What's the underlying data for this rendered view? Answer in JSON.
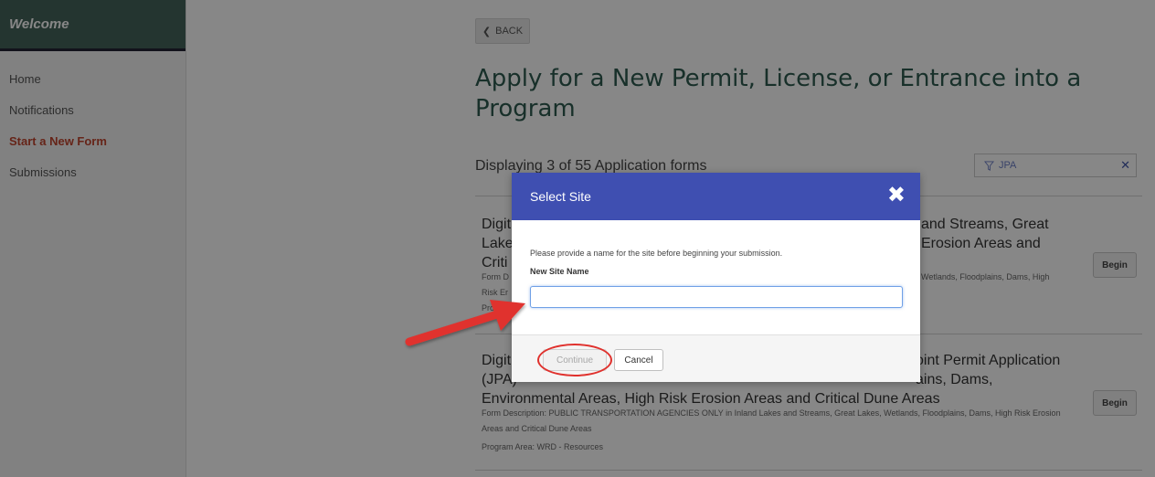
{
  "sidebar": {
    "header": "Welcome",
    "items": [
      {
        "label": "Home"
      },
      {
        "label": "Notifications"
      },
      {
        "label": "Start a New Form",
        "active": true
      },
      {
        "label": "Submissions"
      }
    ]
  },
  "main": {
    "back_label": "BACK",
    "title": "Apply for a New Permit, License, or Entrance into a Program",
    "displaying": "Displaying 3 of 55 Application forms",
    "filter_value": "JPA",
    "forms": [
      {
        "title_left": "Digit\nLake\nCriti",
        "title_right": "and Streams, Great\nErosion Areas and",
        "desc_left": "Form D",
        "desc_right": "Wetlands, Floodplains, Dams, High",
        "desc_left_2": "Risk Er",
        "prog_left": "Pro",
        "begin_label": "Begin"
      },
      {
        "title_line1_left": "Digit",
        "title_line1_right": "oint Permit Application",
        "title_line2_left": "(JPA)",
        "title_line2_right": "ains, Dams,",
        "title_line3": "Environmental Areas, High Risk Erosion Areas and Critical Dune Areas",
        "description": "Form Description: PUBLIC TRANSPORTATION AGENCIES ONLY in Inland Lakes and Streams, Great Lakes, Wetlands, Floodplains, Dams, High Risk Erosion Areas and Critical Dune Areas",
        "program_area": "Program Area: WRD - Resources",
        "begin_label": "Begin"
      }
    ]
  },
  "modal": {
    "title": "Select Site",
    "instruction": "Please provide a name for the site before beginning your submission.",
    "field_label": "New Site Name",
    "field_value": "",
    "continue_label": "Continue",
    "cancel_label": "Cancel"
  },
  "colors": {
    "sidebar_header_bg": "#44645c",
    "active_nav": "#c0442e",
    "modal_header_bg": "#3f4fb1",
    "annotation_red": "#e0312d",
    "title_green": "#2e5b50"
  }
}
